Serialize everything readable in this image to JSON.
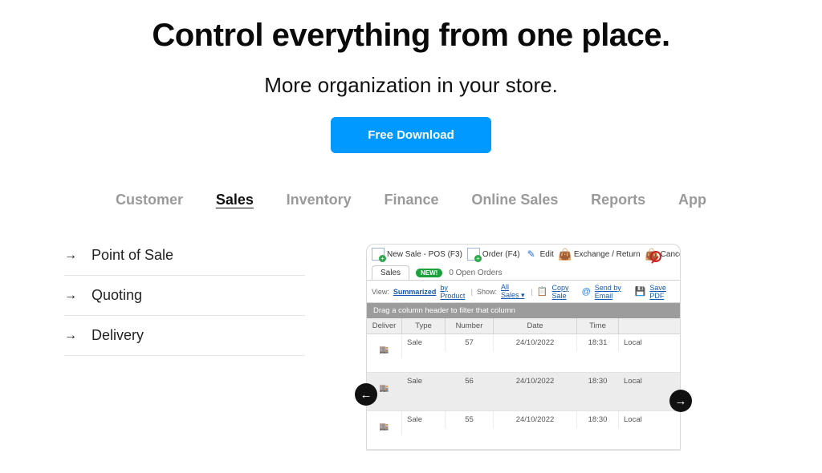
{
  "hero": {
    "headline": "Control everything from one place.",
    "subhead": "More organization in your store.",
    "download": "Free Download"
  },
  "topnav": {
    "items": [
      "Customer",
      "Sales",
      "Inventory",
      "Finance",
      "Online Sales",
      "Reports",
      "App"
    ],
    "active_index": 1
  },
  "sidebar": {
    "items": [
      {
        "label": "Point of Sale"
      },
      {
        "label": "Quoting"
      },
      {
        "label": "Delivery"
      }
    ]
  },
  "app": {
    "toolbar": {
      "new_sale": "New Sale - POS (F3)",
      "order": "Order (F4)",
      "edit": "Edit",
      "exchange": "Exchange / Return",
      "cancel": "Cancel"
    },
    "tabs": {
      "sales": "Sales",
      "new_badge": "NEW!",
      "open_orders": "0 Open Orders"
    },
    "subbar": {
      "view_label": "View:",
      "summarized": "Summarized",
      "by_product": "by Product",
      "show_label": "Show:",
      "all_sales": "All Sales ▾",
      "copy_sale": "Copy Sale",
      "send_email": "Send by Email",
      "save_pdf": "Save PDF"
    },
    "dragbar": "Drag a column header to filter that column",
    "columns": [
      "Deliver",
      "Type",
      "Number",
      "Date",
      "Time",
      ""
    ],
    "last_col_header_hidden": "",
    "rows": [
      {
        "type": "Sale",
        "number": "57",
        "date": "24/10/2022",
        "time": "18:31",
        "channel": "Local",
        "selected": false
      },
      {
        "type": "Sale",
        "number": "56",
        "date": "24/10/2022",
        "time": "18:30",
        "channel": "Local",
        "selected": true
      },
      {
        "type": "Sale",
        "number": "55",
        "date": "24/10/2022",
        "time": "18:30",
        "channel": "Local",
        "selected": false
      }
    ]
  }
}
